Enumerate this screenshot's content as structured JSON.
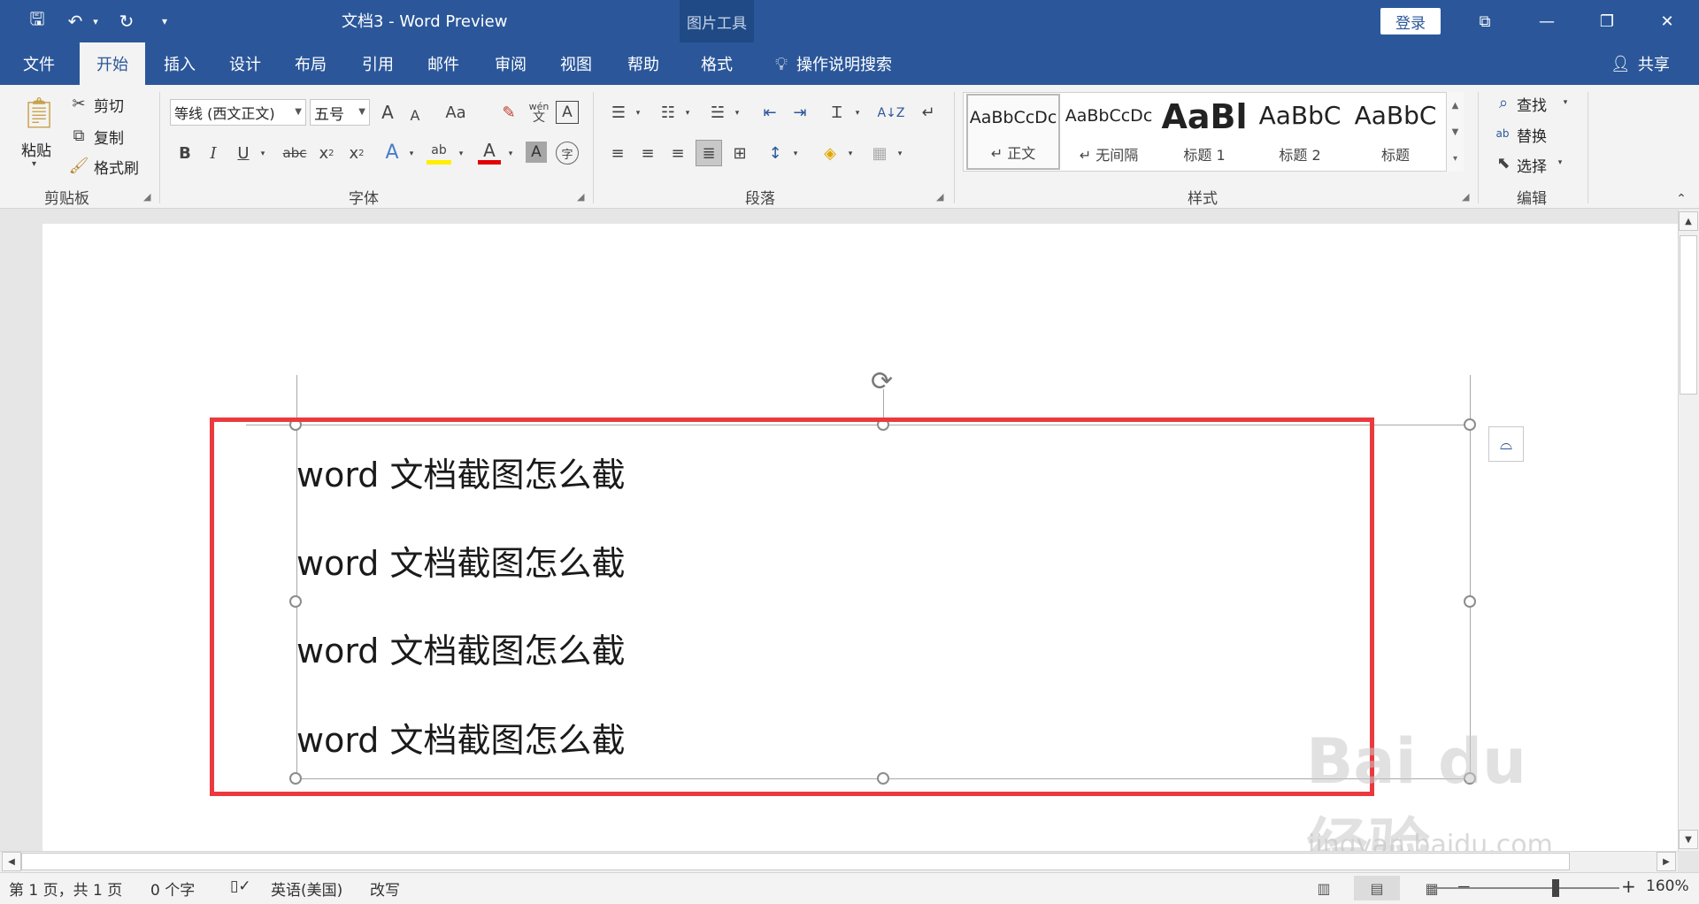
{
  "window": {
    "title": "文档3  -  Word Preview",
    "contextual_tools": "图片工具",
    "login": "登录",
    "minimize_glyph": "—",
    "restore_glyph": "❐",
    "close_glyph": "✕",
    "ribbon_display_glyph": "⧉"
  },
  "quick_access": {
    "save_glyph": "🖫",
    "undo_glyph": "↶",
    "redo_glyph": "↻",
    "customize_glyph": "▾"
  },
  "tabs": [
    {
      "label": "文件"
    },
    {
      "label": "开始"
    },
    {
      "label": "插入"
    },
    {
      "label": "设计"
    },
    {
      "label": "布局"
    },
    {
      "label": "引用"
    },
    {
      "label": "邮件"
    },
    {
      "label": "审阅"
    },
    {
      "label": "视图"
    },
    {
      "label": "帮助"
    },
    {
      "label": "格式"
    }
  ],
  "tell_me": "操作说明搜索",
  "share": "共享",
  "clipboard": {
    "label": "剪贴板",
    "paste": "粘贴",
    "cut": "剪切",
    "copy": "复制",
    "format_painter": "格式刷"
  },
  "font": {
    "label": "字体",
    "name": "等线 (西文正文)",
    "size": "五号",
    "grow": "A",
    "shrink": "A",
    "case": "Aa",
    "bold": "B",
    "italic": "I",
    "underline": "U",
    "strikethrough": "abc",
    "subscript": "x",
    "superscript": "x",
    "phonetic": "wén",
    "phonetic_sub": "文",
    "border_char": "A",
    "effects": "A",
    "highlight": "ab",
    "color": "A",
    "shading": "A",
    "enclose": "字"
  },
  "paragraph": {
    "label": "段落"
  },
  "styles": {
    "label": "样式",
    "items": [
      {
        "sample": "AaBbCcDc",
        "name": "↵ 正文"
      },
      {
        "sample": "AaBbCcDc",
        "name": "↵ 无间隔"
      },
      {
        "sample": "AaBl",
        "name": "标题 1"
      },
      {
        "sample": "AaBbC",
        "name": "标题 2"
      },
      {
        "sample": "AaBbC",
        "name": "标题"
      }
    ]
  },
  "editing": {
    "label": "编辑",
    "find": "查找",
    "replace": "替换",
    "select": "选择"
  },
  "document": {
    "lines": [
      "word 文档截图怎么截",
      "word 文档截图怎么截",
      "word 文档截图怎么截",
      "word 文档截图怎么截"
    ]
  },
  "watermark": {
    "brand": "Bai du 经验",
    "url": "jingyan.baidu.com"
  },
  "statusbar": {
    "page": "第 1 页，共 1 页",
    "words": "0 个字",
    "language": "英语(美国)",
    "mode": "改写",
    "zoom": "160%",
    "zoom_minus": "−",
    "zoom_plus": "+"
  }
}
